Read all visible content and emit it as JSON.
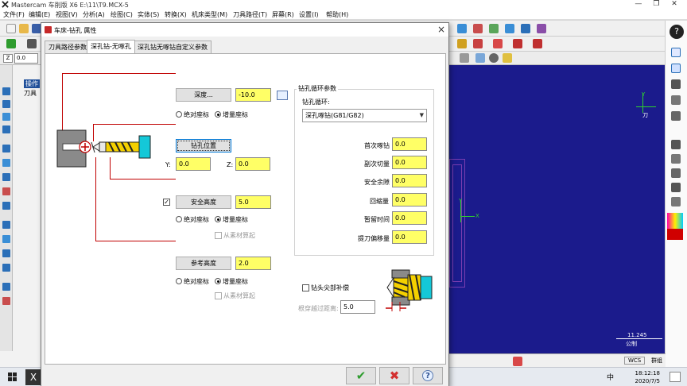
{
  "app": {
    "title": "Mastercam 车削版 X6  E:\\11\\T9.MCX-5",
    "window_buttons": [
      "—",
      "❐",
      "✕"
    ]
  },
  "menu": [
    "文件(F)",
    "编辑(E)",
    "视图(V)",
    "分析(A)",
    "绘图(C)",
    "实体(S)",
    "转换(X)",
    "机床类型(M)",
    "刀具路径(T)",
    "屏幕(R)",
    "设置(I)",
    "帮助(H)"
  ],
  "coord": {
    "label": "Z",
    "value": "0.0"
  },
  "left_panel": {
    "tab1": "操作",
    "tab2": "刀具"
  },
  "viewport": {
    "axis_x": "X",
    "axis_y": "Y",
    "axis_label": "刀",
    "scale_value": "11.245",
    "scale_unit": "公制"
  },
  "statusbar": {
    "wcs": "WCS",
    "group": "群组"
  },
  "taskbar": {
    "time": "18:12:18",
    "date": "2020/7/5",
    "ime": "中"
  },
  "dialog": {
    "title": "车床-钻孔 属性",
    "close": "×",
    "tabs": [
      "刀具路径参数",
      "深孔钻-无啄孔",
      "深孔钻无啄钻自定义参数"
    ],
    "depth": {
      "button": "深度...",
      "value": "-10.0",
      "radio_abs": "绝对座标",
      "radio_inc": "增量座标"
    },
    "drill_point": {
      "button": "钻孔位置",
      "y_label": "Y:",
      "y_value": "0.0",
      "z_label": "Z:",
      "z_value": "0.0"
    },
    "clearance": {
      "button": "安全高度",
      "value": "5.0",
      "radio_abs": "绝对座标",
      "radio_inc": "增量座标",
      "from_stock": "从素材算起"
    },
    "retract": {
      "button": "参考高度",
      "value": "2.0",
      "radio_abs": "绝对座标",
      "radio_inc": "增量座标",
      "from_stock": "从素材算起"
    },
    "cycle": {
      "group_title": "钻孔循环参数",
      "cycle_label": "钻孔循环:",
      "cycle_value": "深孔啄钻(G81/G82)",
      "params": [
        {
          "label": "首次啄钻",
          "value": "0.0"
        },
        {
          "label": "副次切量",
          "value": "0.0"
        },
        {
          "label": "安全余隙",
          "value": "0.0"
        },
        {
          "label": "回缩量",
          "value": "0.0"
        },
        {
          "label": "暂留时间",
          "value": "0.0"
        },
        {
          "label": "提刀偏移量",
          "value": "0.0"
        }
      ]
    },
    "tip_comp": {
      "label": "钻头尖部补偿",
      "break_label": "根穿越过距离:",
      "break_value": "5.0"
    },
    "buttons": {
      "ok": "✔",
      "cancel": "✖",
      "help": "?"
    }
  },
  "colors": {
    "field": "#ffff66",
    "accent_red": "#c00000",
    "viewport": "#1b1b8c",
    "ok": "#2e9c2e",
    "cancel": "#d32f2f"
  }
}
